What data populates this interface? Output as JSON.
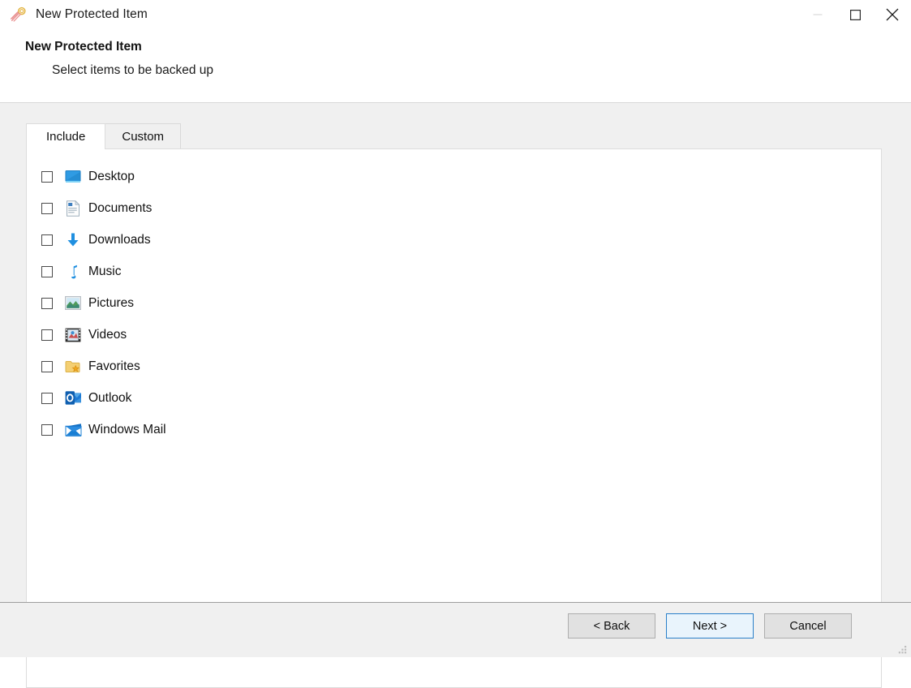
{
  "window": {
    "title": "New Protected Item",
    "app_icon": "comet-icon",
    "controls": {
      "minimize_label": "Minimize",
      "maximize_label": "Maximize",
      "close_label": "Close"
    }
  },
  "header": {
    "title": "New Protected Item",
    "subtitle": "Select items to be backed up"
  },
  "tabs": [
    {
      "label": "Include",
      "active": true
    },
    {
      "label": "Custom",
      "active": false
    }
  ],
  "items": [
    {
      "label": "Desktop",
      "icon": "desktop-icon",
      "checked": false
    },
    {
      "label": "Documents",
      "icon": "documents-icon",
      "checked": false
    },
    {
      "label": "Downloads",
      "icon": "downloads-icon",
      "checked": false
    },
    {
      "label": "Music",
      "icon": "music-icon",
      "checked": false
    },
    {
      "label": "Pictures",
      "icon": "pictures-icon",
      "checked": false
    },
    {
      "label": "Videos",
      "icon": "videos-icon",
      "checked": false
    },
    {
      "label": "Favorites",
      "icon": "favorites-icon",
      "checked": false
    },
    {
      "label": "Outlook",
      "icon": "outlook-icon",
      "checked": false
    },
    {
      "label": "Windows Mail",
      "icon": "windows-mail-icon",
      "checked": false
    }
  ],
  "footer": {
    "back_label": "< Back",
    "next_label": "Next >",
    "cancel_label": "Cancel"
  },
  "colors": {
    "accent": "#2a7fc9",
    "default_button_bg": "#e9f4fc",
    "button_bg": "#e1e1e1",
    "body_bg": "#f0f0f0",
    "panel_bg": "#ffffff"
  }
}
